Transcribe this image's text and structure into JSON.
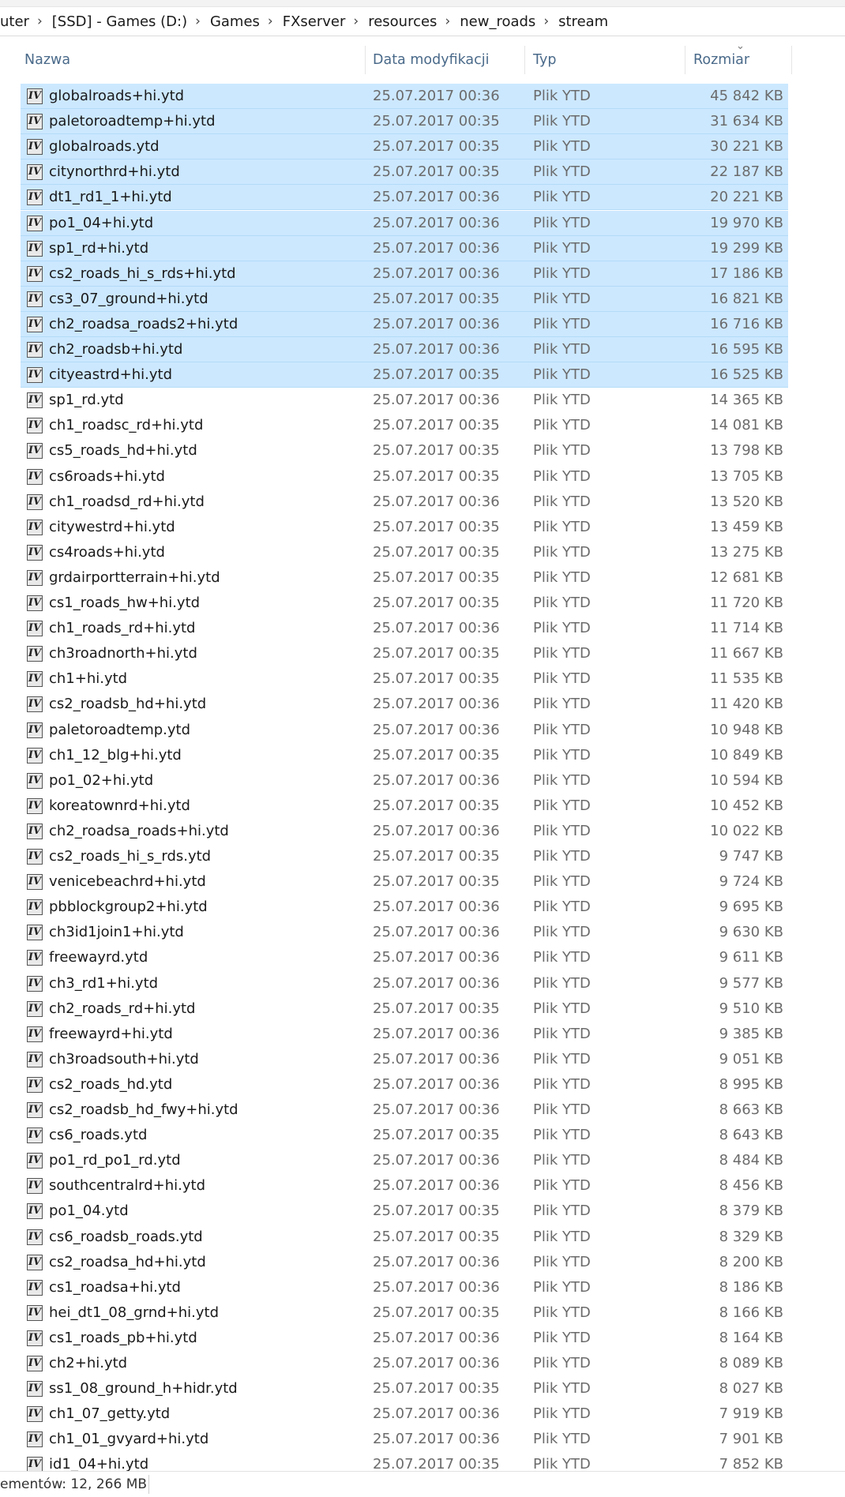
{
  "breadcrumb": [
    "uter",
    "[SSD] - Games (D:)",
    "Games",
    "FXserver",
    "resources",
    "new_roads",
    "stream"
  ],
  "columns": {
    "name": "Nazwa",
    "date": "Data modyfikacji",
    "type": "Typ",
    "size": "Rozmiar"
  },
  "file_icon_glyph": "IV",
  "files": [
    {
      "name": "globalroads+hi.ytd",
      "date": "25.07.2017 00:36",
      "type": "Plik YTD",
      "size": "45 842 KB",
      "selected": true
    },
    {
      "name": "paletoroadtemp+hi.ytd",
      "date": "25.07.2017 00:35",
      "type": "Plik YTD",
      "size": "31 634 KB",
      "selected": true
    },
    {
      "name": "globalroads.ytd",
      "date": "25.07.2017 00:35",
      "type": "Plik YTD",
      "size": "30 221 KB",
      "selected": true
    },
    {
      "name": "citynorthrd+hi.ytd",
      "date": "25.07.2017 00:35",
      "type": "Plik YTD",
      "size": "22 187 KB",
      "selected": true
    },
    {
      "name": "dt1_rd1_1+hi.ytd",
      "date": "25.07.2017 00:36",
      "type": "Plik YTD",
      "size": "20 221 KB",
      "selected": true
    },
    {
      "name": "po1_04+hi.ytd",
      "date": "25.07.2017 00:36",
      "type": "Plik YTD",
      "size": "19 970 KB",
      "selected": true
    },
    {
      "name": "sp1_rd+hi.ytd",
      "date": "25.07.2017 00:36",
      "type": "Plik YTD",
      "size": "19 299 KB",
      "selected": true
    },
    {
      "name": "cs2_roads_hi_s_rds+hi.ytd",
      "date": "25.07.2017 00:36",
      "type": "Plik YTD",
      "size": "17 186 KB",
      "selected": true
    },
    {
      "name": "cs3_07_ground+hi.ytd",
      "date": "25.07.2017 00:35",
      "type": "Plik YTD",
      "size": "16 821 KB",
      "selected": true
    },
    {
      "name": "ch2_roadsa_roads2+hi.ytd",
      "date": "25.07.2017 00:36",
      "type": "Plik YTD",
      "size": "16 716 KB",
      "selected": true
    },
    {
      "name": "ch2_roadsb+hi.ytd",
      "date": "25.07.2017 00:36",
      "type": "Plik YTD",
      "size": "16 595 KB",
      "selected": true
    },
    {
      "name": "cityeastrd+hi.ytd",
      "date": "25.07.2017 00:35",
      "type": "Plik YTD",
      "size": "16 525 KB",
      "selected": true
    },
    {
      "name": "sp1_rd.ytd",
      "date": "25.07.2017 00:36",
      "type": "Plik YTD",
      "size": "14 365 KB",
      "selected": false
    },
    {
      "name": "ch1_roadsc_rd+hi.ytd",
      "date": "25.07.2017 00:35",
      "type": "Plik YTD",
      "size": "14 081 KB",
      "selected": false
    },
    {
      "name": "cs5_roads_hd+hi.ytd",
      "date": "25.07.2017 00:35",
      "type": "Plik YTD",
      "size": "13 798 KB",
      "selected": false
    },
    {
      "name": "cs6roads+hi.ytd",
      "date": "25.07.2017 00:35",
      "type": "Plik YTD",
      "size": "13 705 KB",
      "selected": false
    },
    {
      "name": "ch1_roadsd_rd+hi.ytd",
      "date": "25.07.2017 00:36",
      "type": "Plik YTD",
      "size": "13 520 KB",
      "selected": false
    },
    {
      "name": "citywestrd+hi.ytd",
      "date": "25.07.2017 00:35",
      "type": "Plik YTD",
      "size": "13 459 KB",
      "selected": false
    },
    {
      "name": "cs4roads+hi.ytd",
      "date": "25.07.2017 00:35",
      "type": "Plik YTD",
      "size": "13 275 KB",
      "selected": false
    },
    {
      "name": "grdairportterrain+hi.ytd",
      "date": "25.07.2017 00:35",
      "type": "Plik YTD",
      "size": "12 681 KB",
      "selected": false
    },
    {
      "name": "cs1_roads_hw+hi.ytd",
      "date": "25.07.2017 00:35",
      "type": "Plik YTD",
      "size": "11 720 KB",
      "selected": false
    },
    {
      "name": "ch1_roads_rd+hi.ytd",
      "date": "25.07.2017 00:36",
      "type": "Plik YTD",
      "size": "11 714 KB",
      "selected": false
    },
    {
      "name": "ch3roadnorth+hi.ytd",
      "date": "25.07.2017 00:35",
      "type": "Plik YTD",
      "size": "11 667 KB",
      "selected": false
    },
    {
      "name": "ch1+hi.ytd",
      "date": "25.07.2017 00:35",
      "type": "Plik YTD",
      "size": "11 535 KB",
      "selected": false
    },
    {
      "name": "cs2_roadsb_hd+hi.ytd",
      "date": "25.07.2017 00:36",
      "type": "Plik YTD",
      "size": "11 420 KB",
      "selected": false
    },
    {
      "name": "paletoroadtemp.ytd",
      "date": "25.07.2017 00:36",
      "type": "Plik YTD",
      "size": "10 948 KB",
      "selected": false
    },
    {
      "name": "ch1_12_blg+hi.ytd",
      "date": "25.07.2017 00:35",
      "type": "Plik YTD",
      "size": "10 849 KB",
      "selected": false
    },
    {
      "name": "po1_02+hi.ytd",
      "date": "25.07.2017 00:36",
      "type": "Plik YTD",
      "size": "10 594 KB",
      "selected": false
    },
    {
      "name": "koreatownrd+hi.ytd",
      "date": "25.07.2017 00:35",
      "type": "Plik YTD",
      "size": "10 452 KB",
      "selected": false
    },
    {
      "name": "ch2_roadsa_roads+hi.ytd",
      "date": "25.07.2017 00:36",
      "type": "Plik YTD",
      "size": "10 022 KB",
      "selected": false
    },
    {
      "name": "cs2_roads_hi_s_rds.ytd",
      "date": "25.07.2017 00:35",
      "type": "Plik YTD",
      "size": "9 747 KB",
      "selected": false
    },
    {
      "name": "venicebeachrd+hi.ytd",
      "date": "25.07.2017 00:35",
      "type": "Plik YTD",
      "size": "9 724 KB",
      "selected": false
    },
    {
      "name": "pbblockgroup2+hi.ytd",
      "date": "25.07.2017 00:36",
      "type": "Plik YTD",
      "size": "9 695 KB",
      "selected": false
    },
    {
      "name": "ch3id1join1+hi.ytd",
      "date": "25.07.2017 00:36",
      "type": "Plik YTD",
      "size": "9 630 KB",
      "selected": false
    },
    {
      "name": "freewayrd.ytd",
      "date": "25.07.2017 00:36",
      "type": "Plik YTD",
      "size": "9 611 KB",
      "selected": false
    },
    {
      "name": "ch3_rd1+hi.ytd",
      "date": "25.07.2017 00:36",
      "type": "Plik YTD",
      "size": "9 577 KB",
      "selected": false
    },
    {
      "name": "ch2_roads_rd+hi.ytd",
      "date": "25.07.2017 00:35",
      "type": "Plik YTD",
      "size": "9 510 KB",
      "selected": false
    },
    {
      "name": "freewayrd+hi.ytd",
      "date": "25.07.2017 00:36",
      "type": "Plik YTD",
      "size": "9 385 KB",
      "selected": false
    },
    {
      "name": "ch3roadsouth+hi.ytd",
      "date": "25.07.2017 00:36",
      "type": "Plik YTD",
      "size": "9 051 KB",
      "selected": false
    },
    {
      "name": "cs2_roads_hd.ytd",
      "date": "25.07.2017 00:36",
      "type": "Plik YTD",
      "size": "8 995 KB",
      "selected": false
    },
    {
      "name": "cs2_roadsb_hd_fwy+hi.ytd",
      "date": "25.07.2017 00:36",
      "type": "Plik YTD",
      "size": "8 663 KB",
      "selected": false
    },
    {
      "name": "cs6_roads.ytd",
      "date": "25.07.2017 00:35",
      "type": "Plik YTD",
      "size": "8 643 KB",
      "selected": false
    },
    {
      "name": "po1_rd_po1_rd.ytd",
      "date": "25.07.2017 00:36",
      "type": "Plik YTD",
      "size": "8 484 KB",
      "selected": false
    },
    {
      "name": "southcentralrd+hi.ytd",
      "date": "25.07.2017 00:36",
      "type": "Plik YTD",
      "size": "8 456 KB",
      "selected": false
    },
    {
      "name": "po1_04.ytd",
      "date": "25.07.2017 00:35",
      "type": "Plik YTD",
      "size": "8 379 KB",
      "selected": false
    },
    {
      "name": "cs6_roadsb_roads.ytd",
      "date": "25.07.2017 00:35",
      "type": "Plik YTD",
      "size": "8 329 KB",
      "selected": false
    },
    {
      "name": "cs2_roadsa_hd+hi.ytd",
      "date": "25.07.2017 00:36",
      "type": "Plik YTD",
      "size": "8 200 KB",
      "selected": false
    },
    {
      "name": "cs1_roadsa+hi.ytd",
      "date": "25.07.2017 00:36",
      "type": "Plik YTD",
      "size": "8 186 KB",
      "selected": false
    },
    {
      "name": "hei_dt1_08_grnd+hi.ytd",
      "date": "25.07.2017 00:35",
      "type": "Plik YTD",
      "size": "8 166 KB",
      "selected": false
    },
    {
      "name": "cs1_roads_pb+hi.ytd",
      "date": "25.07.2017 00:36",
      "type": "Plik YTD",
      "size": "8 164 KB",
      "selected": false
    },
    {
      "name": "ch2+hi.ytd",
      "date": "25.07.2017 00:36",
      "type": "Plik YTD",
      "size": "8 089 KB",
      "selected": false
    },
    {
      "name": "ss1_08_ground_h+hidr.ytd",
      "date": "25.07.2017 00:35",
      "type": "Plik YTD",
      "size": "8 027 KB",
      "selected": false
    },
    {
      "name": "ch1_07_getty.ytd",
      "date": "25.07.2017 00:36",
      "type": "Plik YTD",
      "size": "7 919 KB",
      "selected": false
    },
    {
      "name": "ch1_01_gvyard+hi.ytd",
      "date": "25.07.2017 00:36",
      "type": "Plik YTD",
      "size": "7 901 KB",
      "selected": false
    },
    {
      "name": "id1_04+hi.ytd",
      "date": "25.07.2017 00:35",
      "type": "Plik YTD",
      "size": "7 852 KB",
      "selected": false
    }
  ],
  "status": {
    "selection": "ementów: 12, 266 MB"
  },
  "colors": {
    "selection_bg": "#cce8ff",
    "header_text": "#4a6a8a",
    "meta_text": "#6b6b6b"
  }
}
